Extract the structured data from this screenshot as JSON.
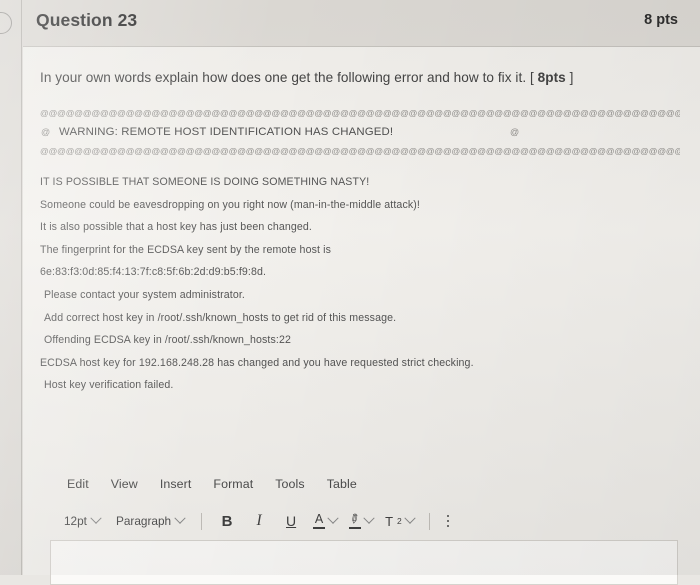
{
  "header": {
    "title": "Question 23",
    "points": "8 pts"
  },
  "question": {
    "prompt_main": "In your own words explain how does one get the following error and how to fix it. [ ",
    "prompt_points": "8pts",
    "prompt_tail": " ]"
  },
  "error_output": {
    "at_border_top": "@@@@@@@@@@@@@@@@@@@@@@@@@@@@@@@@@@@@@@@@@@@@@@@@@@@@@@@@@@@@@@@@@@@@@@@@@@@@@@@@@@@@@@@@@@@@@@",
    "at_border_bottom": "@@@@@@@@@@@@@@@@@@@@@@@@@@@@@@@@@@@@@@@@@@@@@@@@@@@@@@@@@@@@@@@@@@@@@@@@@@@@@@@@@@@@@@@@@@@@@@",
    "warning_at_left": "@",
    "warning_text": "WARNING: REMOTE HOST IDENTIFICATION HAS CHANGED!",
    "warning_at_right": "@",
    "lines": [
      "IT IS POSSIBLE THAT SOMEONE IS DOING SOMETHING NASTY!",
      "Someone could be eavesdropping on you right now (man-in-the-middle attack)!",
      "It is also possible that a host key has just been changed.",
      "The fingerprint for the ECDSA key sent by the remote host is",
      "6e:83:f3:0d:85:f4:13:7f:c8:5f:6b:2d:d9:b5:f9:8d.",
      "Please contact your system administrator.",
      "Add correct host key in /root/.ssh/known_hosts to get rid of this message.",
      "Offending ECDSA key in /root/.ssh/known_hosts:22",
      "ECDSA host key for 192.168.248.28 has changed and you have requested strict checking.",
      "Host key verification failed."
    ]
  },
  "editor": {
    "menu": [
      "Edit",
      "View",
      "Insert",
      "Format",
      "Tools",
      "Table"
    ],
    "font_size": "12pt",
    "block_format": "Paragraph",
    "bold_label": "B",
    "italic_label": "I",
    "underline_label": "U",
    "text_color_label": "A",
    "highlight_label": "✎",
    "superscript_label": "T",
    "superscript_exp": "2",
    "answer_value": "",
    "answer_placeholder": ""
  }
}
